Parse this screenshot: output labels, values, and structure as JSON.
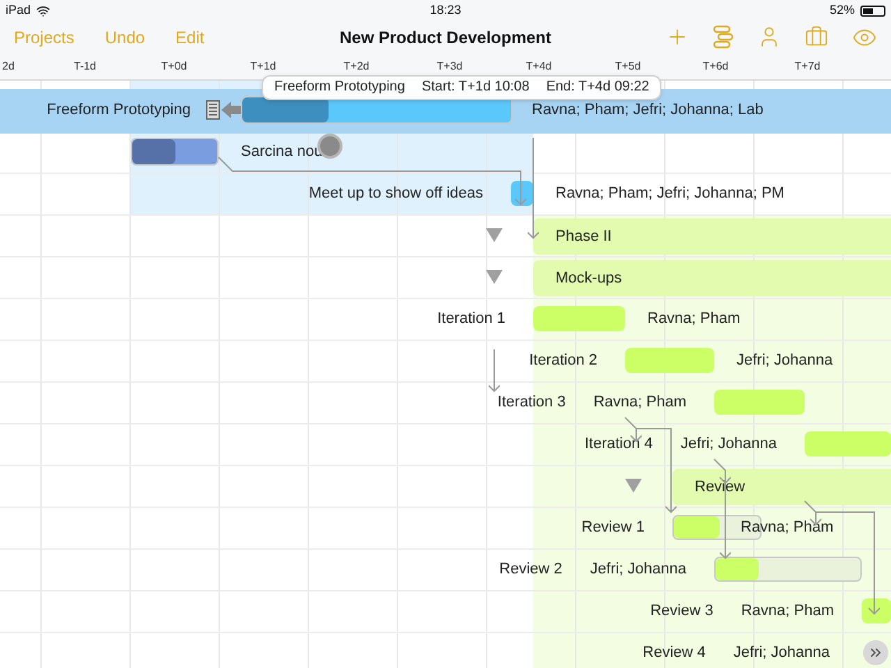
{
  "status_bar": {
    "device": "iPad",
    "time": "18:23",
    "battery": "52%"
  },
  "nav": {
    "buttons": [
      "Projects",
      "Undo",
      "Edit"
    ],
    "title": "New Product Development"
  },
  "timeline": {
    "ticks": [
      "2d",
      "T-1d",
      "T+0d",
      "T+1d",
      "T+2d",
      "T+3d",
      "T+4d",
      "T+5d",
      "T+6d",
      "T+7d"
    ]
  },
  "rows": [
    {
      "kind": "task",
      "label": "Freeform Prototyping",
      "selected": true,
      "level": 0.32,
      "assignees": "Ravna; Pham; Jefri; Johanna; Lab"
    },
    {
      "kind": "task",
      "label": "Sarcina nou",
      "selected": false,
      "level": 0.5
    },
    {
      "kind": "milestone",
      "label": "Meet up to show off ideas",
      "selected": false,
      "assignees": "Ravna; Pham; Jefri; Johanna; PM"
    },
    {
      "kind": "group",
      "label": "Phase II",
      "selected": false,
      "expanded": true
    },
    {
      "kind": "group",
      "label": "Mock-ups",
      "selected": false,
      "expanded": true
    },
    {
      "kind": "task",
      "label": "Iteration 1",
      "selected": false,
      "level": 1,
      "assignees": "Ravna; Pham"
    },
    {
      "kind": "task",
      "label": "Iteration 2",
      "selected": false,
      "level": 1,
      "assignees": "Jefri; Johanna"
    },
    {
      "kind": "task",
      "label": "Iteration 3",
      "selected": false,
      "level": 1,
      "assignees": "Ravna; Pham"
    },
    {
      "kind": "task",
      "label": "Iteration 4",
      "selected": false,
      "level": 1,
      "assignees": "Jefri; Johanna"
    },
    {
      "kind": "group",
      "label": "Review",
      "selected": false,
      "expanded": true
    },
    {
      "kind": "task",
      "label": "Review 1",
      "selected": false,
      "level": 0.53,
      "assignees": "Ravna; Pham"
    },
    {
      "kind": "task",
      "label": "Review 2",
      "selected": false,
      "level": 0.3,
      "assignees": "Jefri; Johanna"
    },
    {
      "kind": "task",
      "label": "Review 3",
      "selected": false,
      "level": 1,
      "assignees": "Ravna; Pham"
    },
    {
      "kind": "task",
      "label": "Review 4",
      "selected": false,
      "assignees": "Jefri; Johanna"
    }
  ],
  "tooltip": {
    "name": "Freeform Prototyping",
    "start": "Start: T+1d 10:08",
    "end": "End: T+4d 09:22"
  }
}
